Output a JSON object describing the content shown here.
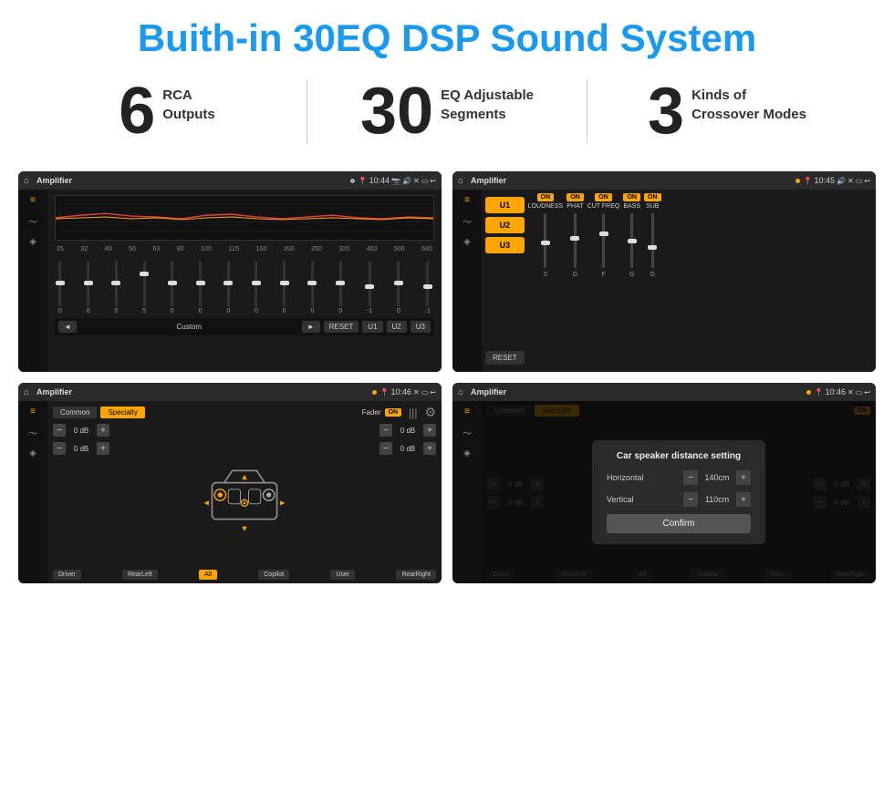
{
  "page": {
    "title": "Buith-in 30EQ DSP Sound System"
  },
  "stats": [
    {
      "number": "6",
      "label": "RCA\nOutputs"
    },
    {
      "number": "30",
      "label": "EQ Adjustable\nSegments"
    },
    {
      "number": "3",
      "label": "Kinds of\nCrossover Modes"
    }
  ],
  "screens": {
    "eq": {
      "title": "Amplifier",
      "time": "10:44",
      "freqs": [
        "25",
        "32",
        "40",
        "50",
        "63",
        "80",
        "100",
        "125",
        "160",
        "200",
        "250",
        "320",
        "400",
        "500",
        "630"
      ],
      "values": [
        "0",
        "0",
        "0",
        "5",
        "0",
        "0",
        "0",
        "0",
        "0",
        "0",
        "0",
        "-1",
        "0",
        "-1"
      ],
      "navItems": [
        "Custom",
        "RESET",
        "U1",
        "U2",
        "U3"
      ]
    },
    "crossover": {
      "title": "Amplifier",
      "time": "10:45",
      "uButtons": [
        "U1",
        "U2",
        "U3"
      ],
      "cols": [
        {
          "label": "LOUDNESS",
          "on": true
        },
        {
          "label": "PHAT",
          "on": true
        },
        {
          "label": "CUT FREQ",
          "on": true
        },
        {
          "label": "BASS",
          "on": true
        },
        {
          "label": "SUB",
          "on": true
        }
      ],
      "resetLabel": "RESET"
    },
    "balance": {
      "title": "Amplifier",
      "time": "10:46",
      "tabs": [
        "Common",
        "Specialty"
      ],
      "activeTab": 1,
      "faderLabel": "Fader",
      "onLabel": "ON",
      "dbRows": [
        {
          "value": "0 dB"
        },
        {
          "value": "0 dB"
        },
        {
          "value": "0 dB"
        },
        {
          "value": "0 dB"
        }
      ],
      "locations": [
        "Driver",
        "RearLeft",
        "All",
        "Copilot",
        "User",
        "RearRight"
      ]
    },
    "dialog": {
      "title": "Amplifier",
      "time": "10:46",
      "dialogTitle": "Car speaker distance setting",
      "rows": [
        {
          "label": "Horizontal",
          "value": "140cm"
        },
        {
          "label": "Vertical",
          "value": "110cm"
        }
      ],
      "confirmLabel": "Confirm",
      "rightDbRows": [
        {
          "value": "0 dB"
        },
        {
          "value": "0 dB"
        }
      ]
    }
  }
}
